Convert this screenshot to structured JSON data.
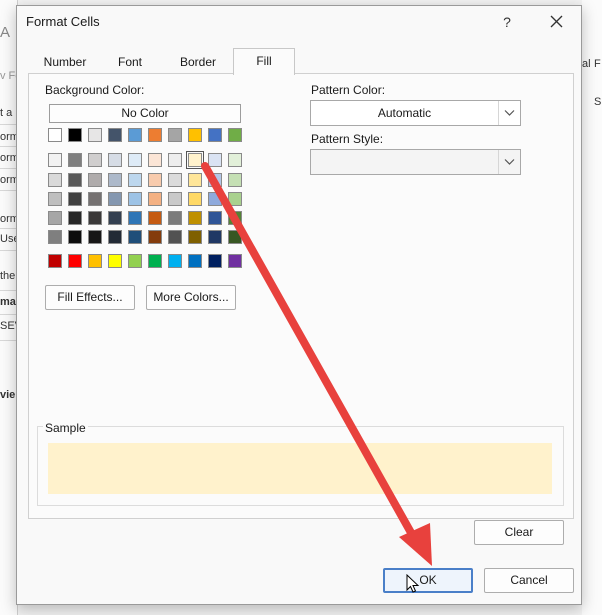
{
  "background": {
    "fragments": [
      "A",
      "v Fo",
      "t a",
      "orm",
      "orm",
      "orm",
      "orm",
      "Use",
      "the",
      "ma",
      "SEV",
      "vie"
    ],
    "right_fragments": [
      "al",
      "F",
      "S"
    ]
  },
  "dialog": {
    "title": "Format Cells",
    "help_label": "?",
    "close_label": "close"
  },
  "tabs": [
    {
      "label": "Number",
      "active": false
    },
    {
      "label": "Font",
      "active": false
    },
    {
      "label": "Border",
      "active": false
    },
    {
      "label": "Fill",
      "active": true
    }
  ],
  "fill": {
    "background_color_label": "Background Color:",
    "background_color_underline": "C",
    "no_color_label": "No Color",
    "pattern_color_label": "Pattern Color:",
    "pattern_color_value": "Automatic",
    "pattern_style_label": "Pattern Style:",
    "pattern_style_value": "",
    "fill_effects_label": "Fill Effects...",
    "more_colors_label": "More Colors...",
    "sample_label": "Sample",
    "sample_color": "#FFF2CC",
    "clear_label": "Clear"
  },
  "palette": {
    "theme_row": [
      "#FFFFFF",
      "#000000",
      "#E7E6E6",
      "#44546A",
      "#5B9BD5",
      "#ED7D31",
      "#A5A5A5",
      "#FFC000",
      "#4472C4",
      "#70AD47"
    ],
    "tint_rows": [
      [
        "#F2F2F2",
        "#7F7F7F",
        "#D0CECE",
        "#D6DCE5",
        "#DEEBF7",
        "#FBE5D6",
        "#EDEDED",
        "#FFF2CC",
        "#DAE3F3",
        "#E2F0D9"
      ],
      [
        "#D9D9D9",
        "#595959",
        "#AFABAB",
        "#ADB9CA",
        "#BDD7EE",
        "#F8CBAD",
        "#DBDBDB",
        "#FFE699",
        "#B4C7E7",
        "#C5E0B4"
      ],
      [
        "#BFBFBF",
        "#404040",
        "#757171",
        "#8497B0",
        "#9DC3E6",
        "#F4B183",
        "#C9C9C9",
        "#FFD966",
        "#8FAADC",
        "#A9D18E"
      ],
      [
        "#A6A6A6",
        "#262626",
        "#3A3838",
        "#333F50",
        "#2E75B6",
        "#C55A11",
        "#7B7B7B",
        "#BF9000",
        "#2F5597",
        "#548235"
      ],
      [
        "#7F7F7F",
        "#0D0D0D",
        "#171616",
        "#222A35",
        "#1F4E79",
        "#843C0C",
        "#525252",
        "#7F6000",
        "#203864",
        "#385723"
      ]
    ],
    "standard_row": [
      "#C00000",
      "#FF0000",
      "#FFC000",
      "#FFFF00",
      "#92D050",
      "#00B050",
      "#00B0F0",
      "#0070C0",
      "#002060",
      "#7030A0"
    ],
    "selected": "#FFF2CC"
  },
  "footer": {
    "ok_label": "OK",
    "cancel_label": "Cancel"
  },
  "annotation": {
    "arrow_color": "#E8413D"
  }
}
